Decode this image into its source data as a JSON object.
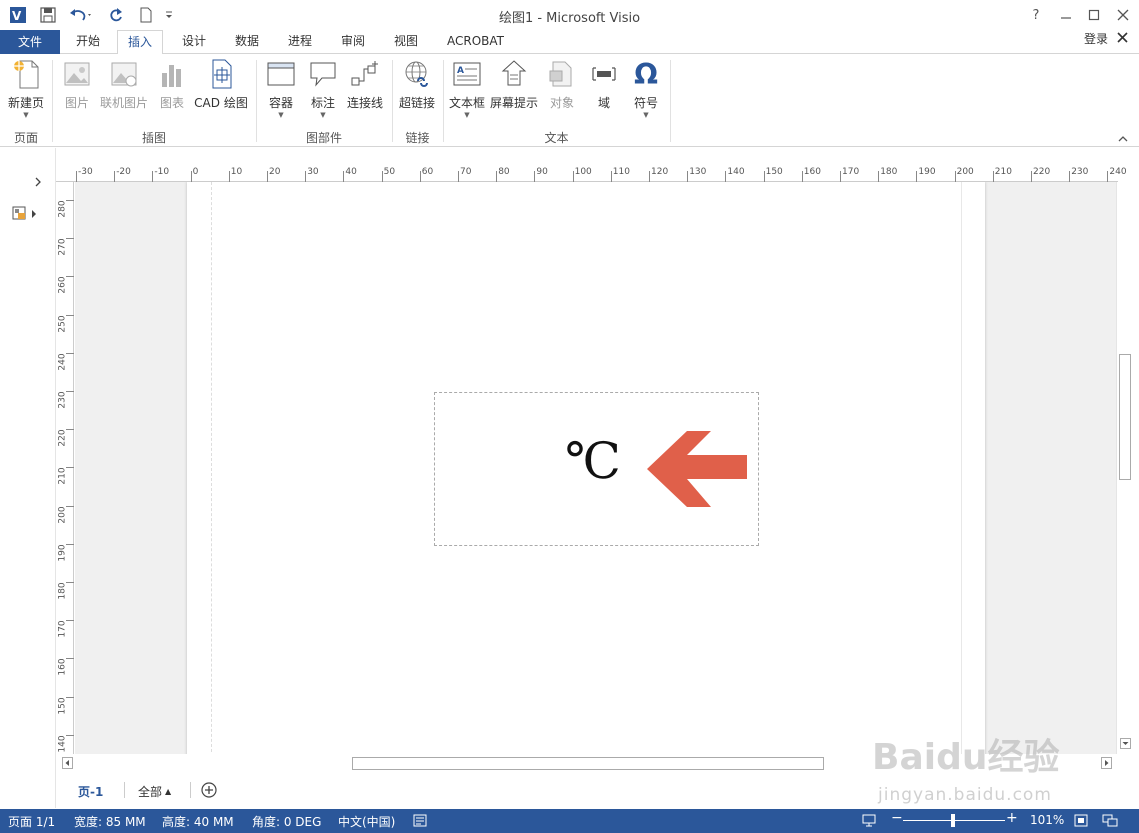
{
  "window": {
    "title": "绘图1 - Microsoft Visio",
    "help": "?",
    "signin": "登录"
  },
  "tabs": {
    "file": "文件",
    "items": [
      "开始",
      "插入",
      "设计",
      "数据",
      "进程",
      "审阅",
      "视图",
      "ACROBAT"
    ],
    "active": "插入"
  },
  "ribbon": {
    "new_page": "新建页",
    "picture": "图片",
    "online_picture": "联机图片",
    "chart": "图表",
    "cad": "CAD 绘图",
    "container": "容器",
    "callout": "标注",
    "connector": "连接线",
    "hyperlink": "超链接",
    "textbox": "文本框",
    "screentip": "屏幕提示",
    "object": "对象",
    "field": "域",
    "symbol": "符号",
    "groups": {
      "pages": "页面",
      "illustrations": "插图",
      "parts": "图部件",
      "links": "链接",
      "text": "文本"
    }
  },
  "ruler": {
    "h_ticks": [
      "-30",
      "-20",
      "-10",
      "0",
      "10",
      "20",
      "30",
      "40",
      "50",
      "60",
      "70",
      "80",
      "90",
      "100",
      "110",
      "120",
      "130",
      "140",
      "150",
      "160",
      "170",
      "180",
      "190",
      "200",
      "210",
      "220",
      "230",
      "240"
    ],
    "v_ticks": [
      "280",
      "270",
      "260",
      "250",
      "240",
      "230",
      "220",
      "210",
      "200",
      "190",
      "180",
      "170",
      "160",
      "150",
      "140"
    ]
  },
  "canvas": {
    "shape_text": "℃",
    "arrow_color": "#e0604a"
  },
  "pagetabs": {
    "page1": "页-1",
    "all": "全部"
  },
  "status": {
    "page": "页面 1/1",
    "width": "宽度: 85 MM",
    "height": "高度: 40 MM",
    "angle": "角度: 0 DEG",
    "lang": "中文(中国)",
    "zoom": "101%"
  },
  "watermark": {
    "brand": "Baidu经验",
    "url": "jingyan.baidu.com"
  },
  "colors": {
    "accent": "#2b579a"
  }
}
